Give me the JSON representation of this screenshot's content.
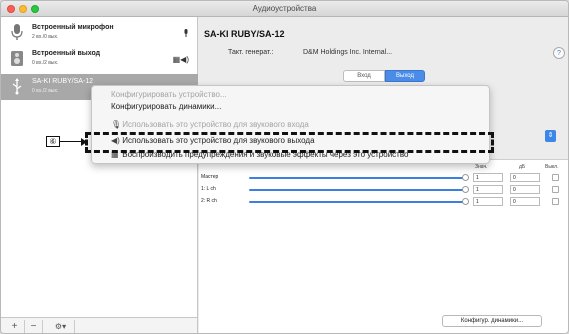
{
  "window": {
    "title": "Аудиоустройства"
  },
  "sidebar": {
    "devices": [
      {
        "name": "Встроенный микрофон",
        "sub": "2 вх./0 вых.",
        "icon": "microphone-icon",
        "right": "🎙"
      },
      {
        "name": "Встроенный выход",
        "sub": "0 вх./2 вых.",
        "icon": "speaker-icon",
        "right": "▦◀)"
      },
      {
        "name": "SA-KI RUBY/SA-12",
        "sub": "0 вх./2 вых.",
        "icon": "usb-icon",
        "right": ""
      }
    ],
    "footer": {
      "add": "+",
      "remove": "−",
      "gear": "⚙▾"
    }
  },
  "main": {
    "device_title": "SA-KI RUBY/SA-12",
    "clock_label": "Такт. генерат.:",
    "clock_value": "D&M Holdings Inc. Internal...",
    "help": "?",
    "tabs": {
      "input": "Вход",
      "output": "Выход"
    },
    "combo_arrow": "⇕",
    "volume": {
      "columns": {
        "value": "Знач.",
        "db": "дБ",
        "mute": "Выкл."
      },
      "rows": [
        {
          "label": "Мастер",
          "value": "1",
          "db": "0",
          "level": 1.0
        },
        {
          "label": "1: L ch",
          "value": "1",
          "db": "0",
          "level": 1.0
        },
        {
          "label": "2: R ch",
          "value": "1",
          "db": "0",
          "level": 1.0
        }
      ]
    },
    "configure_button": "Конфигур. динамики..."
  },
  "context_menu": {
    "items": [
      {
        "label": "Конфигурировать устройство...",
        "disabled": true,
        "icon": ""
      },
      {
        "label": "Конфигурировать динамики...",
        "disabled": false,
        "icon": ""
      },
      {
        "label": "Использовать это устройство для звукового входа",
        "disabled": true,
        "icon": "🎙"
      },
      {
        "label": "Использовать это устройство для звукового выхода",
        "disabled": false,
        "icon": "◀)"
      },
      {
        "label": "Воспроизводить предупреждения и звуковые эффекты через это устройство",
        "disabled": false,
        "icon": "▦"
      }
    ]
  },
  "annotation": {
    "callout": "⑥"
  }
}
